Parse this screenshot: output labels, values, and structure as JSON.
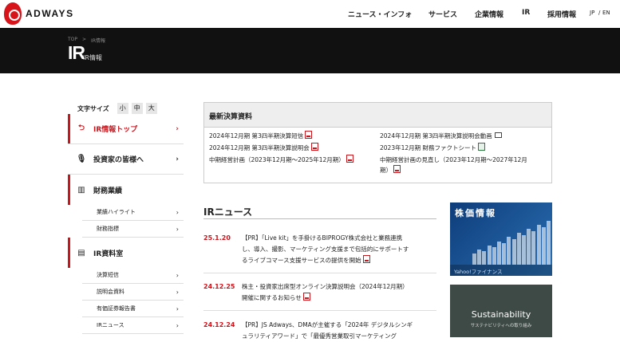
{
  "header": {
    "logo_text": "ADWAYS",
    "nav": [
      "ニュース・インフォ",
      "サービス",
      "企業情報",
      "IR",
      "採用情報"
    ],
    "lang_jp": "JP",
    "lang_sep": "/",
    "lang_en": "EN"
  },
  "hero": {
    "breadcrumb_top": "TOP",
    "breadcrumb_sep": ">",
    "breadcrumb_current": "IR情報",
    "title": "IR",
    "subtitle": "IR情報"
  },
  "font_size": {
    "label": "文字サイズ",
    "small": "小",
    "medium": "中",
    "large": "大"
  },
  "sidebar": {
    "items": [
      {
        "label": "IR情報トップ",
        "icon": "return-arrow-icon"
      },
      {
        "label": "投資家の皆様へ",
        "icon": "microphone-icon"
      },
      {
        "label": "財務業績",
        "icon": "bar-chart-icon"
      },
      {
        "label": "IR資料室",
        "icon": "document-icon"
      }
    ],
    "sub_financial": [
      "業績ハイライト",
      "財務指標"
    ],
    "sub_library": [
      "決算短信",
      "説明会資料",
      "有価証券報告書",
      "IRニュース"
    ],
    "chevron": "›"
  },
  "latest": {
    "heading": "最新決算資料",
    "left": [
      "2024年12月期 第3四半期決算短信",
      "2024年12月期 第3四半期決算説明会",
      "中期経営計画（2023年12月期～2025年12月期）"
    ],
    "right": [
      "2024年12月期 第3四半期決算説明会動画",
      "2023年12月期 財務ファクトシート",
      "中期経営計画の見直し（2023年12月期～2027年12月",
      "期）"
    ]
  },
  "ir_news": {
    "heading": "IRニュース",
    "items": [
      {
        "date": "25.1.20",
        "lines": [
          "【PR】「Live kit」を手掛けるBIPROGY株式会社と業務連携",
          "し、導入、撮影、マーケティング支援まで包括的にサポートす",
          "るライブコマース支援サービスの提供を開始"
        ]
      },
      {
        "date": "24.12.25",
        "lines": [
          "株主・投資家出席型オンライン決算説明会（2024年12月期）",
          "開催に関するお知らせ"
        ]
      },
      {
        "date": "24.12.24",
        "lines": [
          "【PR】JS Adways、DMAが主催する「2024年 デジタルシンギ",
          "ュラリティアワード」で「最優秀営業取引マーケティング"
        ]
      }
    ]
  },
  "banners": {
    "stock_title": "株価情報",
    "stock_footer": "Yahoo!ファイナンス",
    "stock_bars": [
      0.22,
      0.3,
      0.26,
      0.38,
      0.34,
      0.46,
      0.42,
      0.55,
      0.5,
      0.62,
      0.58,
      0.7,
      0.66,
      0.78,
      0.74,
      0.86
    ],
    "sustainability_title": "Sustainability",
    "sustainability_sub": "サステナビリティへの取り組み"
  },
  "colors": {
    "accent": "#c8161d",
    "hero_bg": "#111111"
  }
}
